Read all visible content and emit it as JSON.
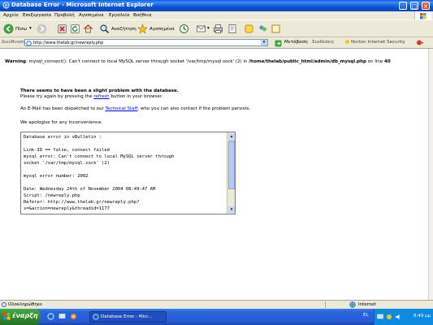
{
  "window": {
    "title": "Database Error - Microsoft Internet Explorer",
    "minimize": "_",
    "maximize": "□",
    "close": "×"
  },
  "menu": [
    "Αρχείο",
    "Επεξεργασία",
    "Προβολή",
    "Αγαπημένα",
    "Εργαλεία",
    "Βοήθεια"
  ],
  "toolbar": {
    "back_label": "Πίσω",
    "search_label": "Αναζήτηση",
    "favorites_label": "Αγαπημένα"
  },
  "address": {
    "label": "Διεύθυνση",
    "url": "http://www.thelab.gr/newreply.php",
    "go_label": "Μετάβαση",
    "links_label": "Συνδέσεις",
    "norton_label": "Norton Internet Security"
  },
  "page": {
    "warning_prefix": "Warning",
    "warning_text": ": mysql_connect(): Can't connect to local MySQL server through socket '/var/tmp/mysql.sock' (2) in",
    "warning_path": "/home/thelab/public_html/admin/db_mysql.php",
    "warning_suffix": "on line",
    "warning_line": "40",
    "heading": "There seems to have been a slight problem with the database.",
    "retry_pre": "Please try again by pressing the",
    "retry_link": "refresh",
    "retry_post": "button in your browser.",
    "email_pre": "An E-Mail has been dispatched to our",
    "email_link": "Technical Staff",
    "email_post": ", who you can also contact if the problem persists.",
    "apology": "We apologise for any inconvenience."
  },
  "error_box": {
    "lines": [
      "Database error in vBulletin :",
      "",
      "Link-ID == false, connect failed",
      "mysql error: Can't connect to local MySQL server through",
      "socket '/var/tmp/mysql.sock' (2)",
      "",
      "mysql error number: 2002",
      "",
      "Date: Wednesday 24th of November 2004 08:49:47 AM",
      "Script: /newreply.php",
      "Referer: http://www.thelab.gr/newreply.php?",
      "s=&action=newreply&threadid=1177"
    ]
  },
  "status": {
    "left": "Ολοκληρώθηκε",
    "zone": "Internet"
  },
  "taskbar": {
    "start_label": "έναρξη",
    "task_label": "Database Error - Micr...",
    "lang": "EL",
    "clock": "8:49 μμ"
  },
  "colors": {
    "titlebar": "#0b53d8",
    "link": "#0000ee",
    "start": "#2f8a2f",
    "taskbar": "#245cd6"
  }
}
